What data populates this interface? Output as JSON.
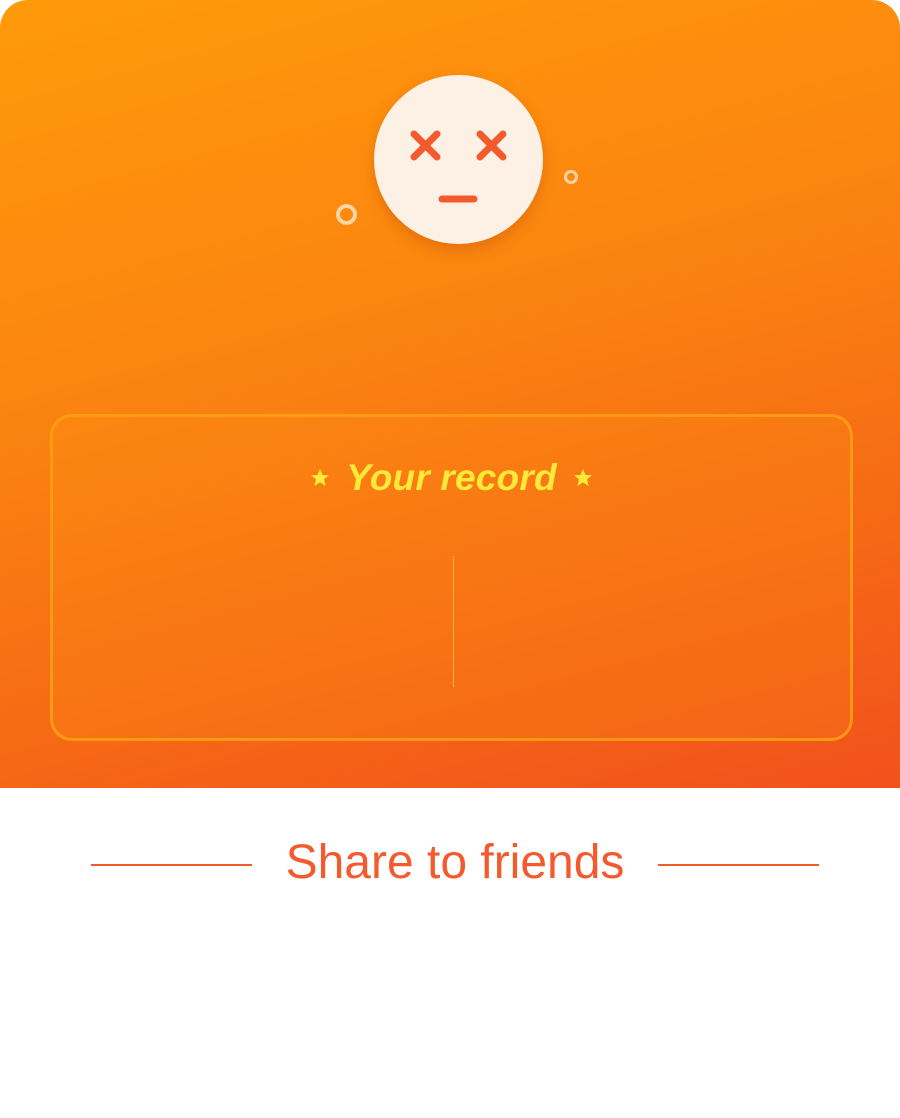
{
  "result_icon": "dizzy-face-icon",
  "record": {
    "title": "Your record",
    "star_icon": "star-icon"
  },
  "share": {
    "title": "Share to friends"
  },
  "colors": {
    "gradient_start": "#ff9a0a",
    "gradient_end": "#f2511c",
    "face_background": "#fdf1e6",
    "face_features": "#f35a2e",
    "record_title": "#fde93a",
    "share_accent": "#f35a2e"
  }
}
